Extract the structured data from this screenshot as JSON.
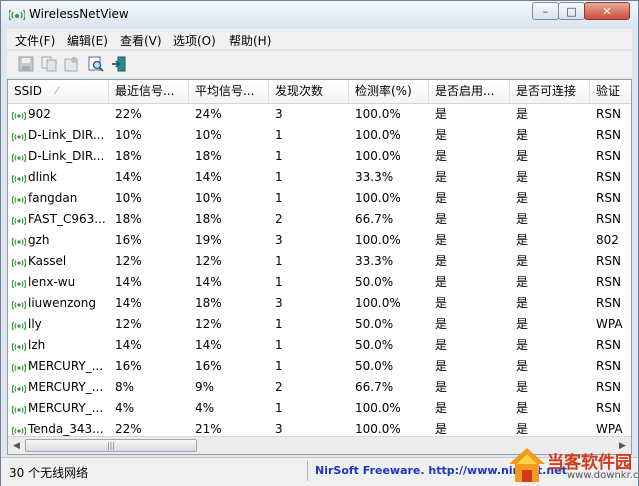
{
  "window": {
    "title": "WirelessNetView"
  },
  "menu": [
    "文件(F)",
    "编辑(E)",
    "查看(V)",
    "选项(O)",
    "帮助(H)"
  ],
  "columns": [
    "SSID",
    "最近信号...",
    "平均信号...",
    "发现次数",
    "检测率(%)",
    "是否启用...",
    "是否可连接",
    "验证"
  ],
  "rows": [
    [
      "902",
      "22%",
      "24%",
      "3",
      "100.0%",
      "是",
      "是",
      "RSN"
    ],
    [
      "D-Link_DIR...",
      "10%",
      "10%",
      "1",
      "100.0%",
      "是",
      "是",
      "RSN"
    ],
    [
      "D-Link_DIR...",
      "18%",
      "18%",
      "1",
      "100.0%",
      "是",
      "是",
      "RSN"
    ],
    [
      "dlink",
      "14%",
      "14%",
      "1",
      "33.3%",
      "是",
      "是",
      "RSN"
    ],
    [
      "fangdan",
      "10%",
      "10%",
      "1",
      "100.0%",
      "是",
      "是",
      "RSN"
    ],
    [
      "FAST_C963...",
      "18%",
      "18%",
      "2",
      "66.7%",
      "是",
      "是",
      "RSN"
    ],
    [
      "gzh",
      "16%",
      "19%",
      "3",
      "100.0%",
      "是",
      "是",
      "802"
    ],
    [
      "Kassel",
      "12%",
      "12%",
      "1",
      "33.3%",
      "是",
      "是",
      "RSN"
    ],
    [
      "lenx-wu",
      "14%",
      "14%",
      "1",
      "50.0%",
      "是",
      "是",
      "RSN"
    ],
    [
      "liuwenzong",
      "14%",
      "18%",
      "3",
      "100.0%",
      "是",
      "是",
      "RSN"
    ],
    [
      "lly",
      "12%",
      "12%",
      "1",
      "50.0%",
      "是",
      "是",
      "WPA"
    ],
    [
      "lzh",
      "14%",
      "14%",
      "1",
      "50.0%",
      "是",
      "是",
      "RSN"
    ],
    [
      "MERCURY_...",
      "16%",
      "16%",
      "1",
      "50.0%",
      "是",
      "是",
      "RSN"
    ],
    [
      "MERCURY_...",
      "8%",
      "9%",
      "2",
      "66.7%",
      "是",
      "是",
      "RSN"
    ],
    [
      "MERCURY_...",
      "4%",
      "4%",
      "1",
      "100.0%",
      "是",
      "是",
      "RSN"
    ],
    [
      "Tenda_343...",
      "22%",
      "21%",
      "3",
      "100.0%",
      "是",
      "是",
      "WPA"
    ]
  ],
  "status": {
    "count": "30 个无线网络",
    "link": "NirSoft Freeware.  http://www.nirsoft.net"
  },
  "watermark": {
    "title": "当客软件园",
    "url": "www.downkr.com"
  },
  "colors": {
    "link": "#1a36c8",
    "watermark": "#d33a1d",
    "wifi_icon": "#2e9a2e"
  }
}
